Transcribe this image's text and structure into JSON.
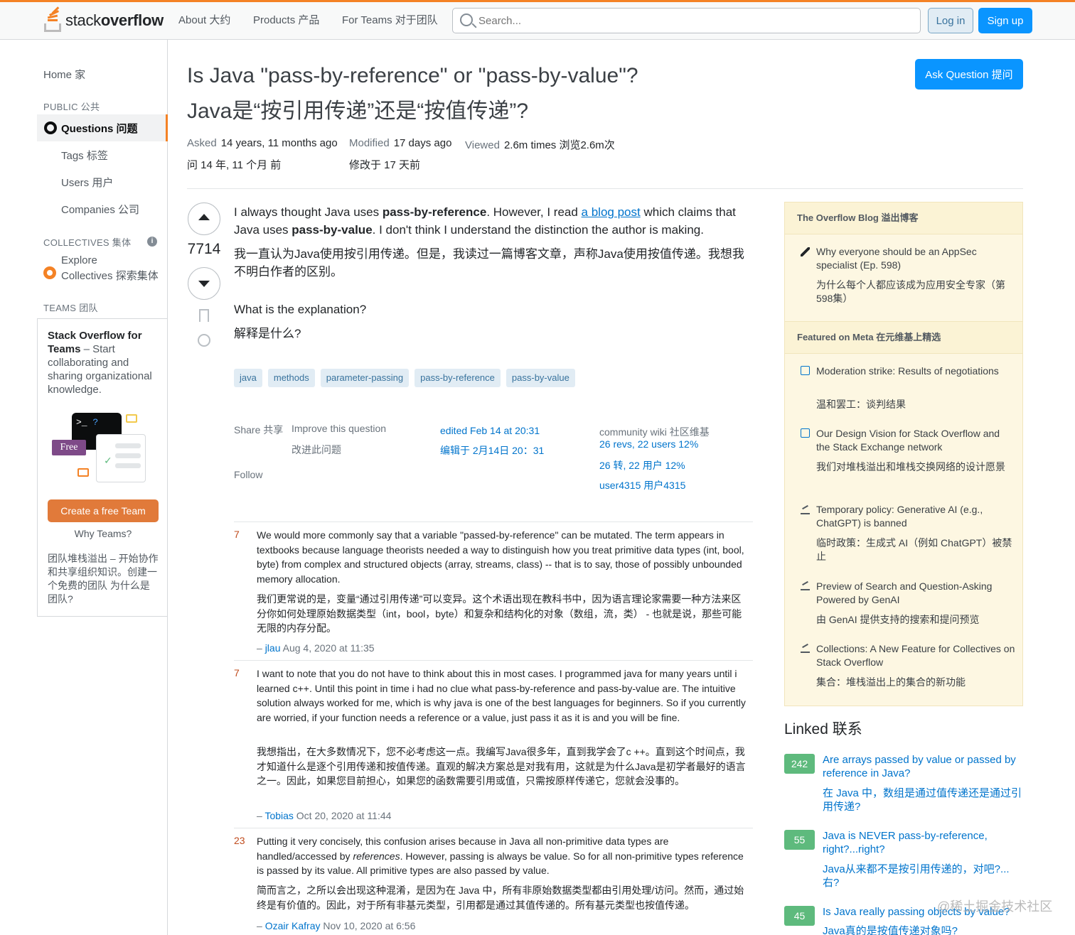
{
  "header": {
    "logo_text_light": "stack",
    "logo_text_bold": "overflow",
    "nav_about": "About 大约",
    "nav_products": "Products 产品",
    "nav_teams": "For Teams 对于团队",
    "search_placeholder": "Search...",
    "login": "Log in",
    "signup": "Sign up",
    "accent_color": "#f48225",
    "primary_color": "#0a95ff"
  },
  "sidebar": {
    "home": "Home  家",
    "public_heading": "PUBLIC 公共",
    "questions": "Questions 问题",
    "tags": "Tags  标签",
    "users": "Users  用户",
    "companies": "Companies  公司",
    "collectives_heading": "COLLECTIVES 集体",
    "explore_line1": "Explore",
    "explore_line2": "Collectives 探索集体",
    "teams_heading": "TEAMS 团队",
    "teams_card": {
      "title_bold": "Stack Overflow for Teams",
      "title_rest": " – Start collaborating and sharing organizational knowledge.",
      "term_prompt": ">_",
      "term_q": "?",
      "free_tag": "Free",
      "create_button": "Create a free Team",
      "why_teams": "Why Teams?",
      "cn_text": "团队堆栈溢出 – 开始协作和共享组织知识。创建一个免费的团队 为什么是团队?"
    }
  },
  "question": {
    "title_en": "Is Java \"pass-by-reference\" or \"pass-by-value\"?",
    "title_cn": "Java是“按引用传递”还是“按值传递”?",
    "ask_button": "Ask Question  提问",
    "asked_label": "Asked",
    "asked_value": "14 years, 11 months ago",
    "asked_cn": "问 14 年,  11 个月 前",
    "modified_label": "Modified",
    "modified_value": "17 days ago",
    "modified_cn": "修改于 17 天前",
    "viewed_label": "Viewed",
    "viewed_value": "2.6m times  浏览2.6m次",
    "votes": "7714",
    "body_1_a": "I always thought Java uses ",
    "body_1_b": "pass-by-reference",
    "body_1_c": ". However, I read ",
    "body_1_link": "a blog post",
    "body_1_d": " which claims that Java uses ",
    "body_1_e": "pass-by-value",
    "body_1_f": ". I don't think I understand the distinction the author is making.",
    "body_1_cn": "我一直认为Java使用按引用传递。但是，我读过一篇博客文章，声称Java使用按值传递。我想我不明白作者的区别。",
    "body_2": "What is the explanation?",
    "body_2_cn": "解释是什么?",
    "tags": [
      "java",
      "methods",
      "parameter-passing",
      "pass-by-reference",
      "pass-by-value"
    ],
    "share": "Share 共享",
    "improve": "Improve this question",
    "improve_cn": "改进此问题",
    "follow": "Follow",
    "edited": "edited Feb 14 at 20:31",
    "edited_cn": "编辑于 2月14日 20：31",
    "wiki": "community wiki  社区维基",
    "revs": "26 revs, 22 users 12%",
    "revs_cn": "26 转,   22 用户 12%",
    "user": "user4315 用户4315"
  },
  "comments": [
    {
      "score": "7",
      "text": "We would more commonly say that a variable \"passed-by-reference\" can be mutated. The term appears in textbooks because language theorists needed a way to distinguish how you treat primitive data types (int, bool, byte) from complex and structured objects (array, streams, class) -- that is to say, those of possibly unbounded memory allocation.",
      "text_cn": "我们更常说的是，变量“通过引用传递”可以变异。这个术语出现在教科书中，因为语言理论家需要一种方法来区分你如何处理原始数据类型（int，bool，byte）和复杂和结构化的对象（数组，流，类） - 也就是说，那些可能无限的内存分配。",
      "dash": "–",
      "user": "jlau",
      "date": "Aug 4, 2020 at 11:35"
    },
    {
      "score": "7",
      "text": "I want to note that you do not have to think about this in most cases. I programmed java for many years until i learned c++. Until this point in time i had no clue what pass-by-reference and pass-by-value are. The intuitive solution always worked for me, which is why java is one of the best languages for beginners. So if you currently are worried, if your function needs a reference or a value, just pass it as it is and you will be fine.",
      "text_cn": "我想指出，在大多数情况下，您不必考虑这一点。我编写Java很多年，直到我学会了c ++。直到这个时间点，我才知道什么是逐个引用传递和按值传递。直观的解决方案总是对我有用，这就是为什么Java是初学者最好的语言之一。因此，如果您目前担心，如果您的函数需要引用或值，只需按原样传递它，您就会没事的。",
      "dash": "–",
      "user": "Tobias",
      "date": "Oct 20, 2020 at 11:44"
    },
    {
      "score": "23",
      "text_a": "Putting it very concisely, this confusion arises because in Java all non-primitive data types are handled/accessed by ",
      "text_em": "references",
      "text_b": ". However, passing is always be value. So for all non-primitive types reference is passed by its value. All primitive types are also passed by value.",
      "text_cn": "简而言之，之所以会出现这种混淆，是因为在 Java 中，所有非原始数据类型都由引用处理/访问。然而，通过始终是有价值的。因此，对于所有非基元类型，引用都是通过其值传递的。所有基元类型也按值传递。",
      "dash": "–",
      "user": "Ozair Kafray",
      "date": "Nov 10, 2020 at 6:56"
    }
  ],
  "blog": {
    "heading": "The Overflow Blog 溢出博客",
    "item1": "Why everyone should be an AppSec specialist (Ep. 598)",
    "item1_cn": "为什么每个人都应该成为应用安全专家（第598集）",
    "meta_heading": "Featured on Meta 在元维基上精选",
    "meta": [
      {
        "en": "Moderation strike: Results of negotiations",
        "cn": "温和罢工：谈判结果"
      },
      {
        "en": "Our Design Vision for Stack Overflow and the Stack Exchange network",
        "cn": "我们对堆栈溢出和堆栈交换网络的设计愿景"
      },
      {
        "en": "Temporary policy: Generative AI (e.g., ChatGPT) is banned",
        "cn": "临时政策：生成式 AI（例如 ChatGPT）被禁止"
      },
      {
        "en": "Preview of Search and Question-Asking Powered by GenAI",
        "cn": "由 GenAI 提供支持的搜索和提问预览"
      },
      {
        "en": "Collections: A New Feature for Collectives on Stack Overflow",
        "cn": "集合：堆栈溢出上的集合的新功能"
      }
    ]
  },
  "linked": {
    "heading": "Linked 联系",
    "items": [
      {
        "score": "242",
        "en": "Are arrays passed by value or passed by reference in Java?",
        "cn": "在 Java 中，数组是通过值传递还是通过引用传递?"
      },
      {
        "score": "55",
        "en": "Java is NEVER pass-by-reference, right?...right?",
        "cn": "Java从来都不是按引用传递的，对吧?...右?"
      },
      {
        "score": "45",
        "en": "Is Java really passing objects by value?",
        "cn": "Java真的是按值传递对象吗?"
      }
    ]
  },
  "watermark": "@稀土掘金技术社区"
}
